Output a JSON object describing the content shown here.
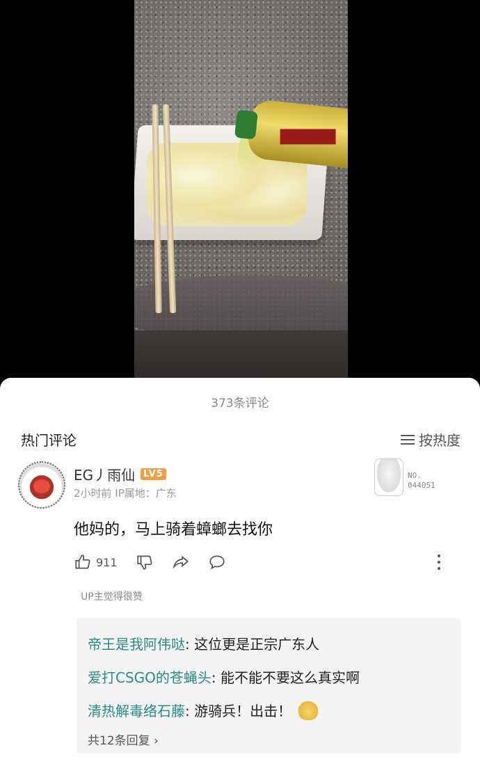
{
  "comments_header": "373条评论",
  "section_title": "热门评论",
  "sort_label": "按热度",
  "comment": {
    "username": "EG丿雨仙",
    "level": "LV5",
    "meta": "2小时前  IP属地：广东",
    "text": "他妈的，马上骑着蟑螂去找你",
    "likes": "911",
    "up_liked": "UP主觉得很赞",
    "nft_label_line1": "NO.",
    "nft_label_line2": "044051"
  },
  "replies": [
    {
      "name": "帝王是我阿伟哒",
      "text": ": 这位更是正宗广东人"
    },
    {
      "name": "爱打CSGO的苍蝇头",
      "text": ": 能不能不要这么真实啊"
    },
    {
      "name": "清热解毒络石藤",
      "text": ": 游骑兵！出击！"
    }
  ],
  "reply_count_label": "共12条回复",
  "colors": {
    "reply_name": "#2a8a8a",
    "level_badge": "#f0a040"
  }
}
